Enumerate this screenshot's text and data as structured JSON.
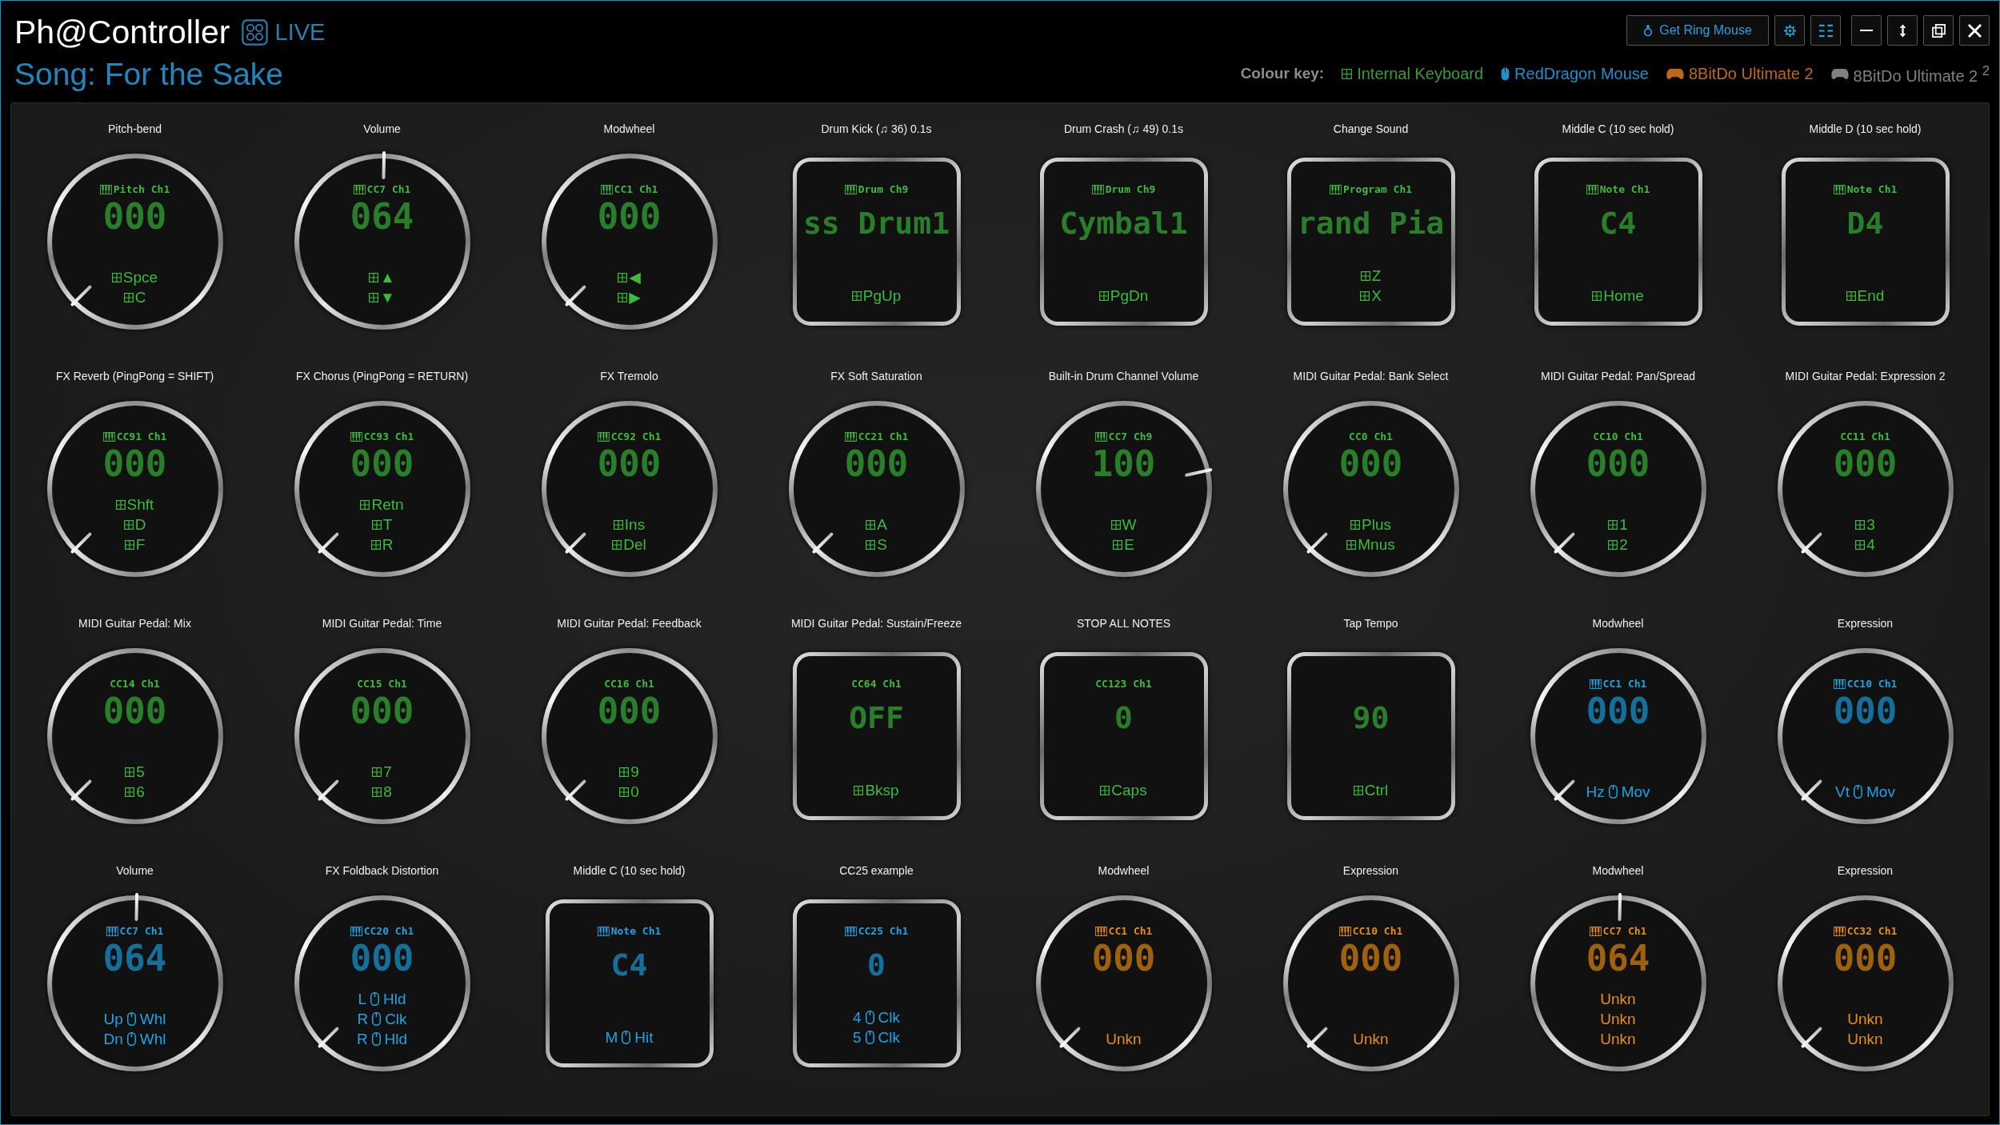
{
  "header": {
    "title": "Ph@Controller",
    "mode": "LIVE",
    "song": "Song: For the Sake"
  },
  "toolbar": {
    "ring_button": "Get Ring Mouse"
  },
  "colour_key": {
    "label": "Colour key:",
    "items": [
      {
        "kind": "keyboard",
        "label": "Internal Keyboard",
        "color": "#3a9a3a"
      },
      {
        "kind": "mouse",
        "label": "RedDragon Mouse",
        "color": "#1f8fd0"
      },
      {
        "kind": "gamepad",
        "label": "8BitDo Ultimate 2",
        "color": "#c0681a"
      },
      {
        "kind": "gamepad",
        "label": "8BitDo Ultimate 2 $^{2}$",
        "color": "#808080"
      }
    ]
  },
  "controls": [
    {
      "label": "Pitch-bend",
      "kind": "knob",
      "channel": "Pitch Ch1",
      "midi_icon": true,
      "value": "000",
      "color": "#3dbb3d",
      "bindings": [
        {
          "kind": "key",
          "text": "Spce"
        },
        {
          "kind": "key",
          "text": "C"
        }
      ]
    },
    {
      "label": "Volume",
      "kind": "knob",
      "channel": "CC7 Ch1",
      "midi_icon": true,
      "value": "064",
      "color": "#3dbb3d",
      "bindings": [
        {
          "kind": "key",
          "text": "▲"
        },
        {
          "kind": "key",
          "text": "▼"
        }
      ]
    },
    {
      "label": "Modwheel",
      "kind": "knob",
      "channel": "CC1 Ch1",
      "midi_icon": true,
      "value": "000",
      "color": "#3dbb3d",
      "bindings": [
        {
          "kind": "key",
          "text": "◀"
        },
        {
          "kind": "key",
          "text": "▶"
        }
      ]
    },
    {
      "label": "Drum Kick (♫ 36) 0.1s",
      "kind": "pad",
      "channel": "Drum Ch9",
      "midi_icon": true,
      "value": "ss Drum1",
      "color": "#3dbb3d",
      "bindings": [
        {
          "kind": "key",
          "text": "PgUp"
        }
      ]
    },
    {
      "label": "Drum Crash (♫ 49) 0.1s",
      "kind": "pad",
      "channel": "Drum Ch9",
      "midi_icon": true,
      "value": "Cymbal1",
      "color": "#3dbb3d",
      "bindings": [
        {
          "kind": "key",
          "text": "PgDn"
        }
      ]
    },
    {
      "label": "Change Sound",
      "kind": "pad",
      "channel": "Program Ch1",
      "midi_icon": true,
      "value": "rand Pia",
      "color": "#3dbb3d",
      "bindings": [
        {
          "kind": "key",
          "text": "Z"
        },
        {
          "kind": "key",
          "text": "X"
        }
      ]
    },
    {
      "label": "Middle C (10 sec hold)",
      "kind": "pad",
      "channel": "Note Ch1",
      "midi_icon": true,
      "value": "C4",
      "color": "#3dbb3d",
      "bindings": [
        {
          "kind": "key",
          "text": "Home"
        }
      ]
    },
    {
      "label": "Middle D (10 sec hold)",
      "kind": "pad",
      "channel": "Note Ch1",
      "midi_icon": true,
      "value": "D4",
      "color": "#3dbb3d",
      "bindings": [
        {
          "kind": "key",
          "text": "End"
        }
      ]
    },
    {
      "label": "FX Reverb (PingPong = SHIFT)",
      "kind": "knob",
      "channel": "CC91 Ch1",
      "midi_icon": true,
      "value": "000",
      "color": "#3dbb3d",
      "bindings": [
        {
          "kind": "key",
          "text": "Shft"
        },
        {
          "kind": "key",
          "text": "D"
        },
        {
          "kind": "key",
          "text": "F"
        }
      ]
    },
    {
      "label": "FX Chorus (PingPong = RETURN)",
      "kind": "knob",
      "channel": "CC93 Ch1",
      "midi_icon": true,
      "value": "000",
      "color": "#3dbb3d",
      "bindings": [
        {
          "kind": "key",
          "text": "Retn"
        },
        {
          "kind": "key",
          "text": "T"
        },
        {
          "kind": "key",
          "text": "R"
        }
      ]
    },
    {
      "label": "FX Tremolo",
      "kind": "knob",
      "channel": "CC92 Ch1",
      "midi_icon": true,
      "value": "000",
      "color": "#3dbb3d",
      "bindings": [
        {
          "kind": "key",
          "text": "Ins"
        },
        {
          "kind": "key",
          "text": "Del"
        }
      ]
    },
    {
      "label": "FX Soft Saturation",
      "kind": "knob",
      "channel": "CC21 Ch1",
      "midi_icon": true,
      "value": "000",
      "color": "#3dbb3d",
      "bindings": [
        {
          "kind": "key",
          "text": "A"
        },
        {
          "kind": "key",
          "text": "S"
        }
      ]
    },
    {
      "label": "Built-in Drum Channel Volume",
      "kind": "knob",
      "channel": "CC7 Ch9",
      "midi_icon": true,
      "value": "100",
      "color": "#3dbb3d",
      "bindings": [
        {
          "kind": "key",
          "text": "W"
        },
        {
          "kind": "key",
          "text": "E"
        }
      ]
    },
    {
      "label": "MIDI Guitar Pedal: Bank Select",
      "kind": "knob",
      "channel": "CC0 Ch1",
      "midi_icon": false,
      "value": "000",
      "color": "#3dbb3d",
      "bindings": [
        {
          "kind": "key",
          "text": "Plus"
        },
        {
          "kind": "key",
          "text": "Mnus"
        }
      ]
    },
    {
      "label": "MIDI Guitar Pedal: Pan/Spread",
      "kind": "knob",
      "channel": "CC10 Ch1",
      "midi_icon": false,
      "value": "000",
      "color": "#3dbb3d",
      "bindings": [
        {
          "kind": "key",
          "text": "1"
        },
        {
          "kind": "key",
          "text": "2"
        }
      ]
    },
    {
      "label": "MIDI Guitar Pedal: Expression 2",
      "kind": "knob",
      "channel": "CC11 Ch1",
      "midi_icon": false,
      "value": "000",
      "color": "#3dbb3d",
      "bindings": [
        {
          "kind": "key",
          "text": "3"
        },
        {
          "kind": "key",
          "text": "4"
        }
      ]
    },
    {
      "label": "MIDI Guitar Pedal: Mix",
      "kind": "knob",
      "channel": "CC14 Ch1",
      "midi_icon": false,
      "value": "000",
      "color": "#3dbb3d",
      "bindings": [
        {
          "kind": "key",
          "text": "5"
        },
        {
          "kind": "key",
          "text": "6"
        }
      ]
    },
    {
      "label": "MIDI Guitar Pedal: Time",
      "kind": "knob",
      "channel": "CC15 Ch1",
      "midi_icon": false,
      "value": "000",
      "color": "#3dbb3d",
      "bindings": [
        {
          "kind": "key",
          "text": "7"
        },
        {
          "kind": "key",
          "text": "8"
        }
      ]
    },
    {
      "label": "MIDI Guitar Pedal: Feedback",
      "kind": "knob",
      "channel": "CC16 Ch1",
      "midi_icon": false,
      "value": "000",
      "color": "#3dbb3d",
      "bindings": [
        {
          "kind": "key",
          "text": "9"
        },
        {
          "kind": "key",
          "text": "0"
        }
      ]
    },
    {
      "label": "MIDI Guitar Pedal: Sustain/Freeze",
      "kind": "pad",
      "channel": "CC64 Ch1",
      "midi_icon": false,
      "value": "OFF",
      "color": "#3dbb3d",
      "bindings": [
        {
          "kind": "key",
          "text": "Bksp"
        }
      ]
    },
    {
      "label": "STOP ALL NOTES",
      "kind": "pad",
      "channel": "CC123 Ch1",
      "midi_icon": false,
      "value": "0",
      "color": "#3dbb3d",
      "bindings": [
        {
          "kind": "key",
          "text": "Caps"
        }
      ]
    },
    {
      "label": "Tap Tempo",
      "kind": "pad",
      "midi_icon": false,
      "value": "90",
      "color": "#3dbb3d",
      "bindings": [
        {
          "kind": "key",
          "text": "Ctrl"
        }
      ]
    },
    {
      "label": "Modwheel",
      "kind": "knob",
      "channel": "CC1 Ch1",
      "midi_icon": true,
      "value": "000",
      "color": "#1ea4e4",
      "bindings": [
        {
          "kind": "mouse",
          "button": "Hz",
          "text": "Mov"
        }
      ]
    },
    {
      "label": "Expression",
      "kind": "knob",
      "channel": "CC10 Ch1",
      "midi_icon": true,
      "value": "000",
      "color": "#1ea4e4",
      "bindings": [
        {
          "kind": "mouse",
          "button": "Vt",
          "text": "Mov"
        }
      ]
    },
    {
      "label": "Volume",
      "kind": "knob",
      "channel": "CC7 Ch1",
      "midi_icon": true,
      "value": "064",
      "color": "#1ea4e4",
      "bindings": [
        {
          "kind": "mouse",
          "button": "Up",
          "text": "Whl"
        },
        {
          "kind": "mouse",
          "button": "Dn",
          "text": "Whl"
        }
      ]
    },
    {
      "label": "FX Foldback Distortion",
      "kind": "knob",
      "channel": "CC20 Ch1",
      "midi_icon": true,
      "value": "000",
      "color": "#1ea4e4",
      "bindings": [
        {
          "kind": "mouse",
          "button": "L",
          "text": "Hld"
        },
        {
          "kind": "mouse",
          "button": "R",
          "text": "Clk"
        },
        {
          "kind": "mouse",
          "button": "R",
          "text": "Hld"
        }
      ]
    },
    {
      "label": "Middle C (10 sec hold)",
      "kind": "pad",
      "channel": "Note Ch1",
      "midi_icon": true,
      "value": "C4",
      "color": "#1ea4e4",
      "bindings": [
        {
          "kind": "mouse",
          "button": "M",
          "text": "Hit"
        }
      ]
    },
    {
      "label": "CC25 example",
      "kind": "pad",
      "channel": "CC25 Ch1",
      "midi_icon": true,
      "value": "0",
      "color": "#1ea4e4",
      "bindings": [
        {
          "kind": "mouse",
          "button": "4",
          "text": "Clk"
        },
        {
          "kind": "mouse",
          "button": "5",
          "text": "Clk"
        }
      ]
    },
    {
      "label": "Modwheel",
      "kind": "knob",
      "channel": "CC1 Ch1",
      "midi_icon": true,
      "value": "000",
      "color": "#e88e14",
      "bindings": [
        {
          "kind": "gamepad",
          "text": "Unkn"
        }
      ]
    },
    {
      "label": "Expression",
      "kind": "knob",
      "channel": "CC10 Ch1",
      "midi_icon": true,
      "value": "000",
      "color": "#e88e14",
      "bindings": [
        {
          "kind": "gamepad",
          "text": "Unkn"
        }
      ]
    },
    {
      "label": "Modwheel",
      "kind": "knob",
      "channel": "CC7 Ch1",
      "midi_icon": true,
      "value": "064",
      "color": "#e88e14",
      "bindings": [
        {
          "kind": "gamepad",
          "text": "Unkn"
        },
        {
          "kind": "gamepad",
          "text": "Unkn"
        },
        {
          "kind": "gamepad",
          "text": "Unkn"
        }
      ]
    },
    {
      "label": "Expression",
      "kind": "knob",
      "channel": "CC32 Ch1",
      "midi_icon": true,
      "value": "000",
      "color": "#e88e14",
      "bindings": [
        {
          "kind": "gamepad",
          "text": "Unkn"
        },
        {
          "kind": "gamepad",
          "text": "Unkn"
        }
      ]
    }
  ]
}
